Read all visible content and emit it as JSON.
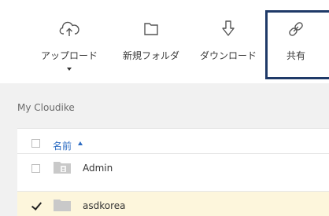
{
  "toolbar": {
    "upload_label": "アップロード",
    "new_folder_label": "新規フォルダ",
    "download_label": "ダウンロード",
    "share_label": "共有"
  },
  "breadcrumb": "My Cloudike",
  "table": {
    "name_header": "名前"
  },
  "files": [
    {
      "name": "Admin",
      "checked": false
    },
    {
      "name": "asdkorea",
      "checked": true
    }
  ],
  "colors": {
    "share_highlight_border": "#1f3a68",
    "selected_row_bg": "#fdf6dc",
    "sort_header_link": "#2d6cc2"
  }
}
